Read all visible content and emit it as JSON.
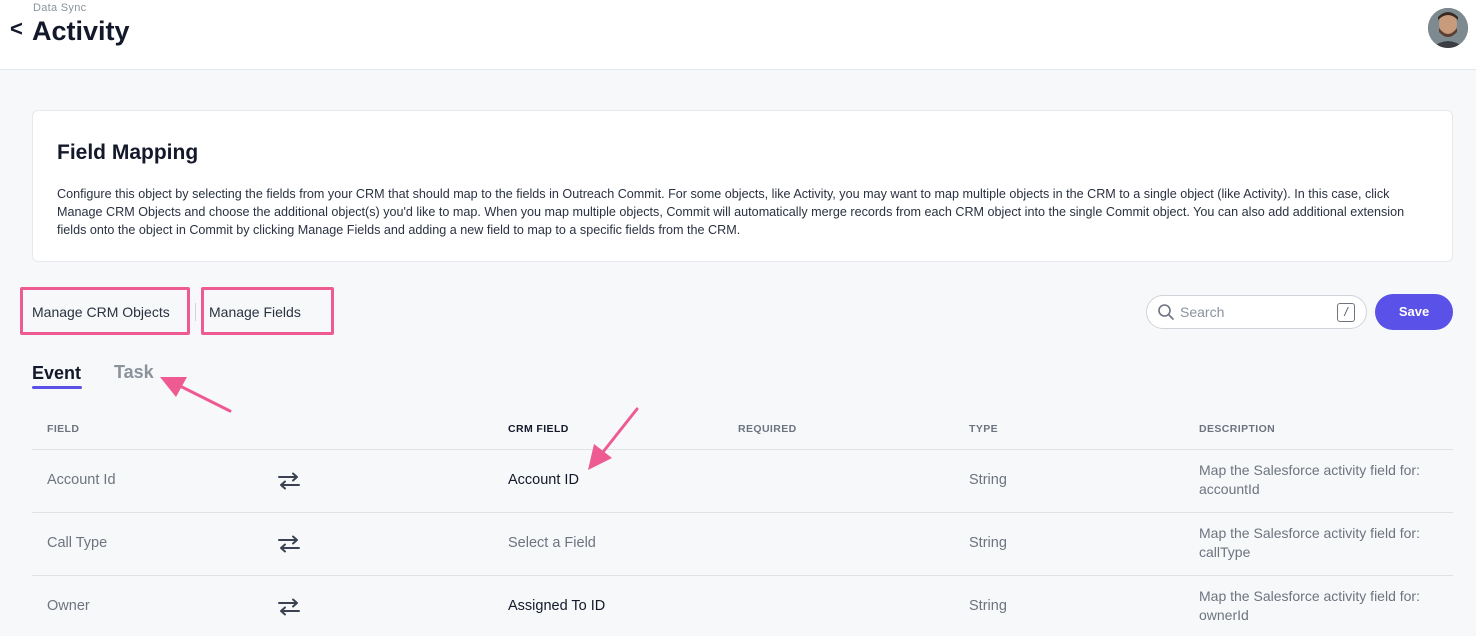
{
  "header": {
    "breadcrumb": "Data Sync",
    "back_glyph": "<",
    "title": "Activity"
  },
  "card": {
    "title": "Field Mapping",
    "description": "Configure this object by selecting the fields from your CRM that should map to the fields in Outreach Commit. For some objects, like Activity, you may want to map multiple objects in the CRM to a single object (like Activity). In this case, click Manage CRM Objects and choose the additional object(s) you'd like to map. When you map multiple objects, Commit will automatically merge records from each CRM object into the single Commit object. You can also add additional extension fields onto the object in Commit by clicking Manage Fields and adding a new field to map to a specific fields from the CRM."
  },
  "toolbar": {
    "manage_crm_objects": "Manage CRM Objects",
    "manage_fields": "Manage Fields",
    "search_placeholder": "Search",
    "search_shortcut": "/",
    "save_label": "Save"
  },
  "tabs": [
    {
      "label": "Event",
      "active": true
    },
    {
      "label": "Task",
      "active": false
    }
  ],
  "table": {
    "columns": [
      "FIELD",
      "CRM FIELD",
      "REQUIRED",
      "TYPE",
      "DESCRIPTION"
    ],
    "rows": [
      {
        "field": "Account Id",
        "crm_field": "Account ID",
        "crm_selected": true,
        "required": "",
        "type": "String",
        "description": "Map the Salesforce activity field for: accountId"
      },
      {
        "field": "Call Type",
        "crm_field": "Select a Field",
        "crm_selected": false,
        "required": "",
        "type": "String",
        "description": "Map the Salesforce activity field for: callType"
      },
      {
        "field": "Owner",
        "crm_field": "Assigned To ID",
        "crm_selected": true,
        "required": "",
        "type": "String",
        "description": "Map the Salesforce activity field for: ownerId"
      }
    ]
  },
  "colors": {
    "accent": "#5951e8",
    "highlight": "#ee5b93",
    "text_dark": "#13182b",
    "text_muted": "#6d7480"
  },
  "icons": {
    "back": "chevron-left-icon",
    "search": "search-icon",
    "swap": "swap-arrows-icon",
    "avatar": "user-avatar"
  }
}
